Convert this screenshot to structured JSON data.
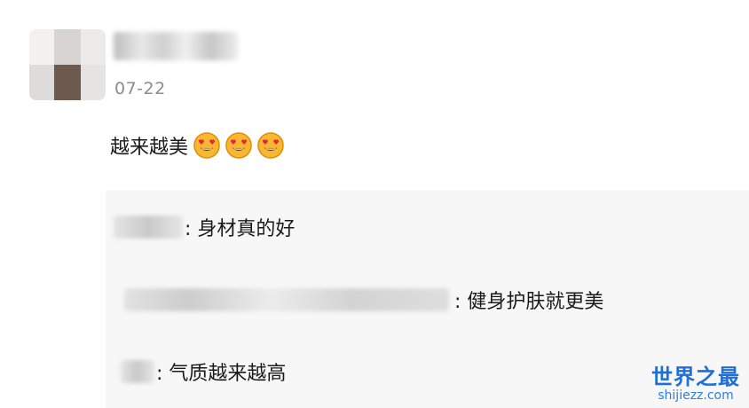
{
  "comment": {
    "date": "07-22",
    "text": "越来越美",
    "emojis": [
      "heart-eyes-emoji",
      "heart-eyes-emoji",
      "heart-eyes-emoji"
    ]
  },
  "replies": [
    {
      "text": ": 身材真的好"
    },
    {
      "text": ": 健身护肤就更美"
    },
    {
      "text": ": 气质越来越高"
    }
  ],
  "watermark": {
    "title": "世界之最",
    "url": "shijiezz.com"
  },
  "colors": {
    "reply_background": "#f7f7f8",
    "date_text": "#8c8c8c",
    "watermark": "#1e6fd8"
  }
}
